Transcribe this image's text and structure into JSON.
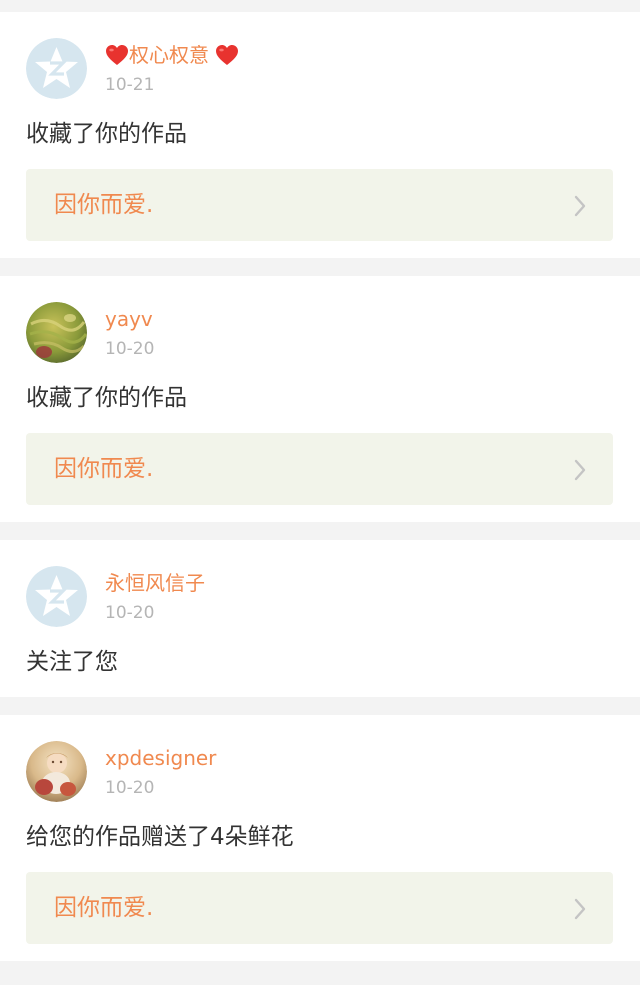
{
  "feed": {
    "items": [
      {
        "user": "权心权意",
        "heart_icons": [
          "heart-icon",
          "heart-icon"
        ],
        "date": "10-21",
        "action": "收藏了你的作品",
        "work_title": "因你而爱.",
        "avatar_icon": "default-star-avatar-icon"
      },
      {
        "user": "yayv",
        "date": "10-20",
        "action": "收藏了你的作品",
        "work_title": "因你而爱.",
        "avatar_icon": "user-photo-avatar"
      },
      {
        "user": "永恒风信子",
        "date": "10-20",
        "action": "关注了您",
        "avatar_icon": "default-star-avatar-icon"
      },
      {
        "user": "xpdesigner",
        "date": "10-20",
        "action": "给您的作品赠送了4朵鲜花",
        "work_title": "因你而爱.",
        "avatar_icon": "user-photo-avatar"
      }
    ]
  },
  "colors": {
    "accent": "#f0894f",
    "background": "#f3f3f3",
    "card": "#ffffff",
    "work_link_bg": "#f2f4ea",
    "date": "#b5b5b5",
    "text": "#333333",
    "heart": "#e8332f"
  }
}
